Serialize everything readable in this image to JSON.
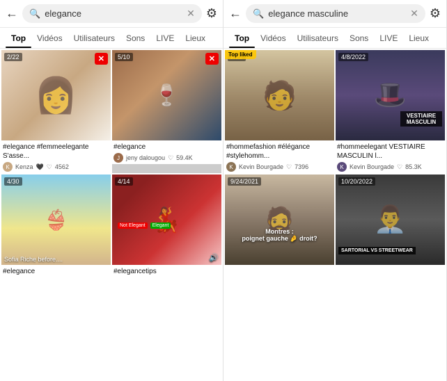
{
  "left_panel": {
    "search_query": "elegance",
    "tabs": [
      "Top",
      "Vidéos",
      "Utilisateurs",
      "Sons",
      "LIVE",
      "Lieux"
    ],
    "active_tab": "Top",
    "cards": [
      {
        "id": "card-1",
        "bg_class": "bg-woman-white",
        "counter": "2/22",
        "has_x": true,
        "title": "#elegance #femmeelegante S'asse...",
        "author": "Kenza",
        "likes": "4562",
        "has_heart": true,
        "emoji": "🖤"
      },
      {
        "id": "card-2",
        "bg_class": "bg-hand-drink",
        "counter": "5/10",
        "has_x": true,
        "title": "#elegance",
        "author": "jeny dalougou",
        "likes": "59.4K",
        "has_heart": true
      },
      {
        "id": "card-3",
        "bg_class": "bg-beach",
        "counter": "4/30",
        "title": "#elegance",
        "label": "Sofia Riche before....",
        "author": "",
        "likes": "",
        "has_heart": false
      },
      {
        "id": "card-4",
        "bg_class": "bg-woman-red",
        "counter": "4/14",
        "title": "#elegancetips",
        "label": "Not Elegant  Elegant",
        "has_sound": true,
        "author": "",
        "likes": "",
        "has_heart": false
      }
    ]
  },
  "right_panel": {
    "search_query": "elegance masculine",
    "tabs": [
      "Top",
      "Vidéos",
      "Utilisateurs",
      "Sons",
      "LIVE",
      "Lieux"
    ],
    "active_tab": "Top",
    "cards": [
      {
        "id": "card-r1",
        "bg_class": "bg-man-casual",
        "counter": "2/22",
        "badge": "Top liked",
        "title": "#hommefashion #élégance #stylehomm...",
        "author": "Kevin Bourgade",
        "likes": "7396",
        "has_heart": true
      },
      {
        "id": "card-r2",
        "bg_class": "bg-man-suit",
        "counter": "4/8/2022",
        "brand": "VESTIAIRE MASCULIN",
        "title": "#hommeelegant VESTIAIRE MASCULIN l...",
        "author": "Kevin Bourgade",
        "likes": "85.3K",
        "has_heart": true
      },
      {
        "id": "card-r3",
        "bg_class": "bg-man-watch",
        "counter": "9/24/2021",
        "title": "",
        "montres_text": "Montres : poignet gauche 🤌 droit?",
        "author": "",
        "likes": "",
        "has_heart": false
      },
      {
        "id": "card-r4",
        "bg_class": "bg-man-sartorial",
        "counter": "10/20/2022",
        "sartorial": "SARTORIAL VS STREETWEAR",
        "title": "",
        "author": "",
        "likes": "",
        "has_heart": false
      }
    ]
  },
  "icons": {
    "back": "←",
    "search": "🔍",
    "clear": "✕",
    "filter": "⚙",
    "heart": "♡",
    "sound": "🔊",
    "x_mark": "✕"
  }
}
